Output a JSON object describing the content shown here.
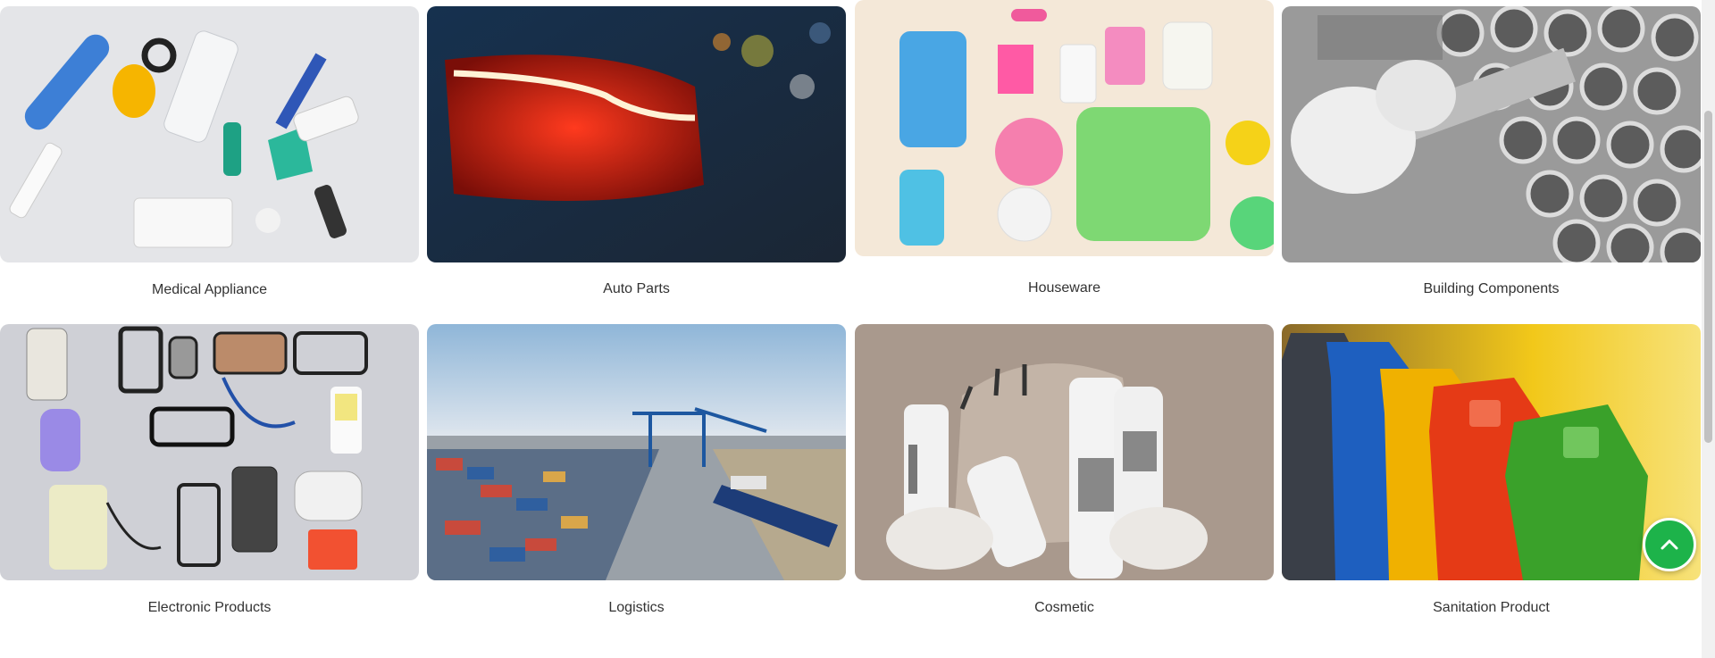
{
  "categories": [
    {
      "label": "Medical Appliance"
    },
    {
      "label": "Auto Parts"
    },
    {
      "label": "Houseware"
    },
    {
      "label": "Building Components"
    },
    {
      "label": "Electronic Products"
    },
    {
      "label": "Logistics"
    },
    {
      "label": "Cosmetic"
    },
    {
      "label": "Sanitation Product"
    }
  ],
  "back_to_top": {
    "icon": "chevron-up-icon",
    "color": "#1db34a"
  }
}
